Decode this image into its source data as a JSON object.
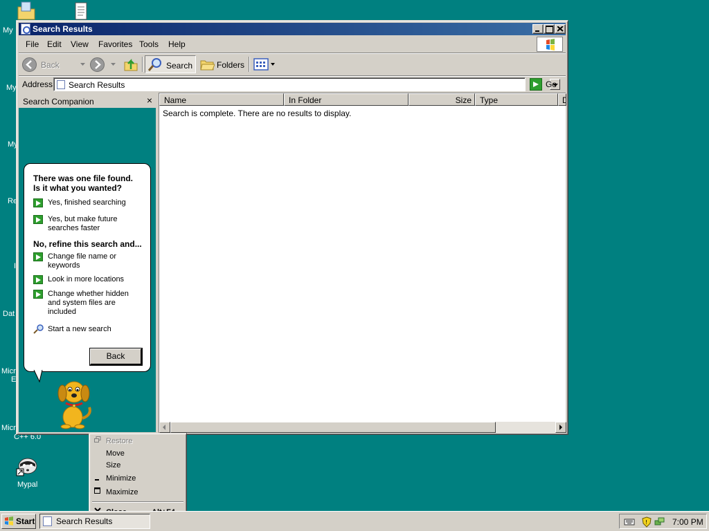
{
  "desktop": {
    "icons": [
      {
        "label": "My",
        "icon": "my-documents-icon"
      },
      {
        "label": "My",
        "icon": "my-computer-icon"
      },
      {
        "label": "My",
        "icon": "my-network-icon"
      },
      {
        "label": "Re",
        "icon": "recycle-bin-icon"
      },
      {
        "label": "I",
        "icon": "internet-icon"
      },
      {
        "label": "Dat",
        "icon": "database-icon"
      },
      {
        "label": "Micr",
        "icon": "microsoft-app-icon"
      },
      {
        "label": "E",
        "icon": "microsoft-app-icon"
      },
      {
        "label": "Micr",
        "icon": "visual-cpp-icon"
      },
      {
        "label": "C++ 6.0",
        "icon": "visual-cpp-icon"
      },
      {
        "label": "Mypal",
        "icon": "mypal-raccoon-icon"
      }
    ]
  },
  "window": {
    "title": "Search Results",
    "menu": [
      "File",
      "Edit",
      "View",
      "Favorites",
      "Tools",
      "Help"
    ],
    "toolbar": {
      "back": "Back",
      "search": "Search",
      "folders": "Folders"
    },
    "address": {
      "label": "Address",
      "value": "Search Results",
      "go": "Go"
    }
  },
  "companion": {
    "title": "Search Companion",
    "close": "×",
    "heading1": "There was one file found.",
    "heading2": "Is it what you wanted?",
    "options_yes": [
      "Yes, finished searching",
      "Yes, but make future searches faster"
    ],
    "refine_heading": "No, refine this search and...",
    "options_refine": [
      "Change file name or keywords",
      "Look in more locations",
      "Change whether hidden and system files are included"
    ],
    "new_search": "Start a new search",
    "back_button": "Back"
  },
  "results": {
    "columns": [
      "Name",
      "In Folder",
      "Size",
      "Type",
      "D"
    ],
    "message": "Search is complete. There are no results to display."
  },
  "system_menu": {
    "items": [
      {
        "label": "Restore",
        "enabled": false
      },
      {
        "label": "Move",
        "enabled": true
      },
      {
        "label": "Size",
        "enabled": true
      },
      {
        "label": "Minimize",
        "enabled": true
      },
      {
        "label": "Maximize",
        "enabled": true
      }
    ],
    "close": {
      "label": "Close",
      "shortcut": "Alt+F4"
    }
  },
  "taskbar": {
    "start": "Start",
    "task": "Search Results",
    "clock": "7:00 PM"
  },
  "colors": {
    "desktop": "#008080",
    "titlebar_start": "#0a246a",
    "titlebar_end": "#3a6ea5",
    "face": "#d4d0c8",
    "go_green": "#2e9e2e"
  }
}
